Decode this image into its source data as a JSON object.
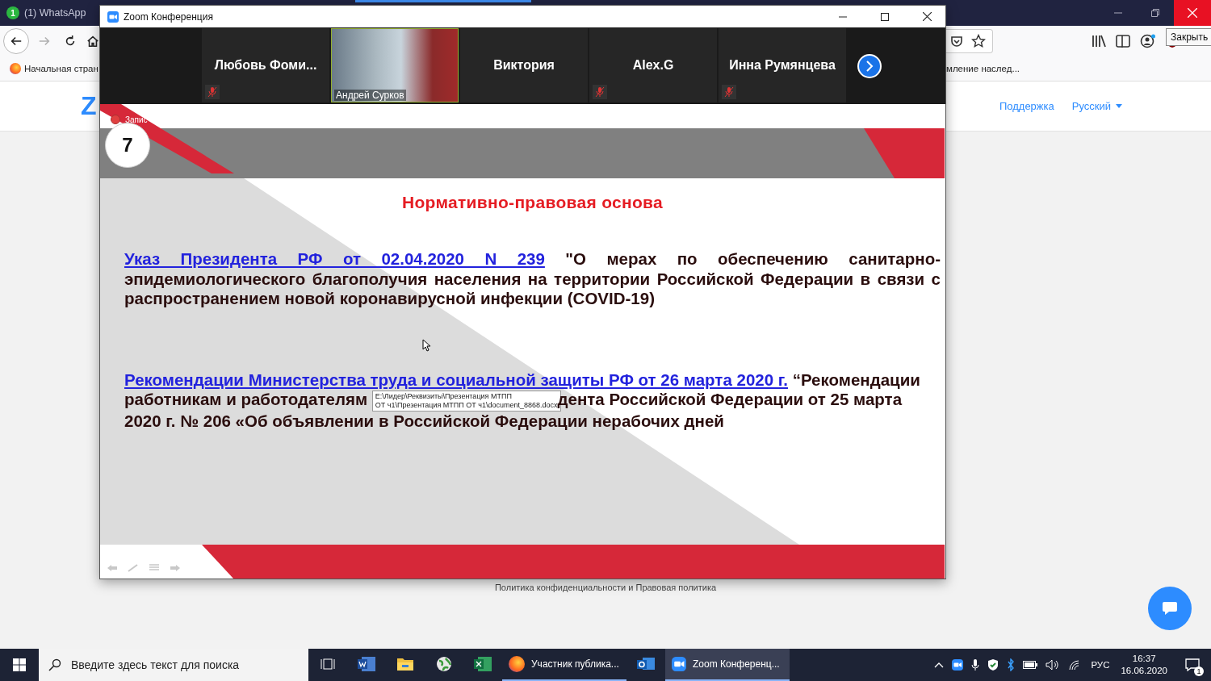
{
  "browser": {
    "tabs": [
      {
        "label": "(1) WhatsApp",
        "icon_badge": "1"
      }
    ],
    "nav_buttons": [
      {
        "kind": "back",
        "disabled": false
      },
      {
        "kind": "forward",
        "disabled": true
      },
      {
        "kind": "reload",
        "disabled": false
      },
      {
        "kind": "home",
        "disabled": false
      }
    ],
    "bookmarks": [
      {
        "label": "Начальная стран"
      },
      {
        "label": "мление наслед..."
      }
    ],
    "close_tooltip": "Закрыть",
    "page": {
      "logo": "Z",
      "links": [
        {
          "label": "Поддержка",
          "dropdown": false
        },
        {
          "label": "Русский",
          "dropdown": true
        }
      ],
      "footer": "Политика конфиденциальности и Правовая политика"
    }
  },
  "zoom": {
    "title": "Zoom Конференция",
    "participants": [
      {
        "kind": "name",
        "name": "Любовь Фоми...",
        "muted": true,
        "speaking": false
      },
      {
        "kind": "video",
        "name": "Андрей Сурков",
        "muted": false,
        "speaking": true
      },
      {
        "kind": "name",
        "name": "Виктория",
        "muted": false,
        "speaking": false
      },
      {
        "kind": "name",
        "name": "Alex.G",
        "muted": true,
        "speaking": false
      },
      {
        "kind": "name",
        "name": "Инна Румянцева",
        "muted": true,
        "speaking": false
      }
    ],
    "recording_label": "Запис",
    "slide": {
      "number": "7",
      "title": "Нормативно-правовая основа",
      "paragraph_1": {
        "link": "Указ Президента РФ от 02.04.2020 N 239",
        "text": " \"О мерах по обеспечению санитарно-эпидемиологического благополучия населения на территории Российской Федерации в связи с распространением новой коронавирусной инфекции (COVID-19)"
      },
      "paragraph_2": {
        "link": "Рекомендации Министерства труда и социальной защиты РФ от 26 марта 2020 г.",
        "text_before": "“Рекомендации работникам и работодателям",
        "text_after": "дента Российской Федерации от 25 марта 2020 г. № 206 «Об объявлении в Российской Федерации нерабочих дней"
      },
      "tooltip_lines": [
        "E:\\Лидер\\Реквизиты\\Презентация МТПП",
        "ОТ ч1\\Презентация МТПП ОТ ч1\\document_8868.docx"
      ]
    }
  },
  "taskbar": {
    "search_placeholder": "Введите здесь текст для поиска",
    "apps": [
      {
        "kind": "taskview",
        "running": false,
        "selected": false
      },
      {
        "kind": "word",
        "running": false,
        "selected": false
      },
      {
        "kind": "explorer",
        "running": false,
        "selected": false
      },
      {
        "kind": "globe",
        "running": false,
        "selected": false
      },
      {
        "kind": "excel",
        "running": false,
        "selected": false
      },
      {
        "kind": "firefox",
        "label": "Участник публика...",
        "running": true,
        "selected": false
      },
      {
        "kind": "outlook",
        "running": false,
        "selected": false
      },
      {
        "kind": "zoom",
        "label": "Zoom Конференц...",
        "running": true,
        "selected": true
      }
    ],
    "language": "РУС",
    "time": "16:37",
    "date": "16.06.2020",
    "notifications": "1"
  }
}
